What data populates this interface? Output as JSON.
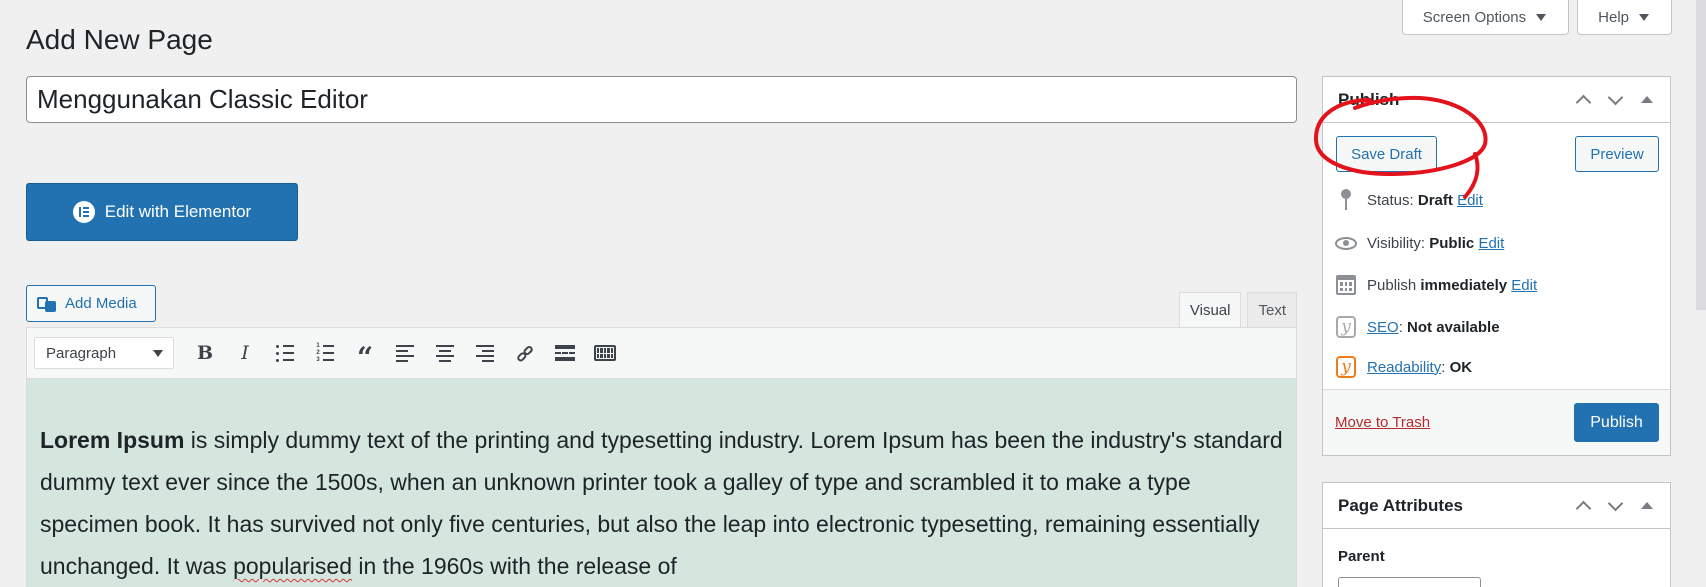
{
  "header": {
    "screen_options_label": "Screen Options",
    "help_label": "Help",
    "page_title": "Add New Page"
  },
  "title_field": {
    "value": "Menggunakan Classic Editor"
  },
  "elementor": {
    "label": "Edit with Elementor"
  },
  "media": {
    "add_media_label": "Add Media"
  },
  "editor": {
    "tabs": [
      {
        "label": "Visual",
        "active": true
      },
      {
        "label": "Text",
        "active": false
      }
    ],
    "format_select": "Paragraph",
    "toolbar_icons": [
      "bold-icon",
      "italic-icon",
      "bullet-list-icon",
      "numbered-list-icon",
      "blockquote-icon",
      "align-left-icon",
      "align-center-icon",
      "align-right-icon",
      "link-icon",
      "read-more-icon",
      "toolbar-toggle-icon"
    ],
    "content": {
      "bold_lead": "Lorem Ipsum",
      "text_1": " is simply dummy text of the printing and typesetting industry. Lorem Ipsum has been the industry's standard dummy text ever since the 1500s, when an unknown printer took a galley of type and scrambled it to make a type specimen book. It has survived not only five centuries, but also the leap into electronic typesetting, remaining essentially unchanged. It was ",
      "misspelled": "popularised",
      "text_2": " in the 1960s with the release of"
    },
    "background_color": "#d5e6df"
  },
  "publish_box": {
    "title": "Publish",
    "save_draft_label": "Save Draft",
    "preview_label": "Preview",
    "status": {
      "label": "Status:",
      "value": "Draft",
      "edit": "Edit"
    },
    "visibility": {
      "label": "Visibility:",
      "value": "Public",
      "edit": "Edit"
    },
    "schedule": {
      "label": "Publish",
      "value": "immediately",
      "edit": "Edit"
    },
    "seo": {
      "link": "SEO",
      "value": "Not available"
    },
    "readability": {
      "link": "Readability",
      "value": "OK"
    },
    "trash_label": "Move to Trash",
    "publish_label": "Publish"
  },
  "attributes_box": {
    "title": "Page Attributes",
    "parent_label": "Parent"
  },
  "colors": {
    "primary": "#2271b1",
    "trash": "#b32d2e",
    "annotation": "#e3121b",
    "readability": "#ee7c1b"
  }
}
